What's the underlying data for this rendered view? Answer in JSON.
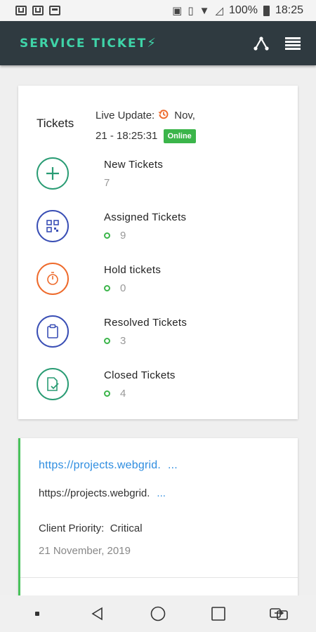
{
  "status_bar": {
    "battery_text": "100%",
    "time": "18:25",
    "left_icons": [
      "mail-icon",
      "mail-icon",
      "image-icon"
    ],
    "right_icons": [
      "nfc-icon",
      "vibrate-icon",
      "wifi-icon",
      "no-signal-icon",
      "battery-icon"
    ]
  },
  "appbar": {
    "title": "SERVICE TICKET",
    "icons": [
      "share-icon",
      "menu-icon"
    ],
    "brand_color": "#3fd4a8",
    "background": "#2f3a40"
  },
  "summary": {
    "title": "Tickets",
    "live_update_label": "Live Update:",
    "live_update_time_part1": "Nov,",
    "live_update_time_part2": "21 - 18:25:31",
    "status_badge": "Online",
    "items": [
      {
        "label": "New Tickets",
        "count": "7",
        "icon": "plus-icon",
        "color": "#2a9c74"
      },
      {
        "label": "Assigned Tickets",
        "count": "9",
        "icon": "qr-icon",
        "color": "#3a4fb5"
      },
      {
        "label": "Hold tickets",
        "count": "0",
        "icon": "timer-icon",
        "color": "#ee6a2b"
      },
      {
        "label": "Resolved Tickets",
        "count": "3",
        "icon": "clipboard-icon",
        "color": "#3a4fb5"
      },
      {
        "label": "Closed Tickets",
        "count": "4",
        "icon": "document-check-icon",
        "color": "#2a9c74"
      }
    ]
  },
  "ticket_card": {
    "link_title": "https://projects.webgrid.",
    "link_title_more": "...",
    "link_subtitle": "https://projects.webgrid.",
    "link_subtitle_more": "...",
    "priority_label": "Client Priority:",
    "priority_value": "Critical",
    "date": "21 November, 2019",
    "accent_color": "#49c25b"
  },
  "navbar": {
    "icons": [
      "dot-icon",
      "back-icon",
      "home-icon",
      "recents-icon",
      "screen-switch-icon"
    ]
  }
}
